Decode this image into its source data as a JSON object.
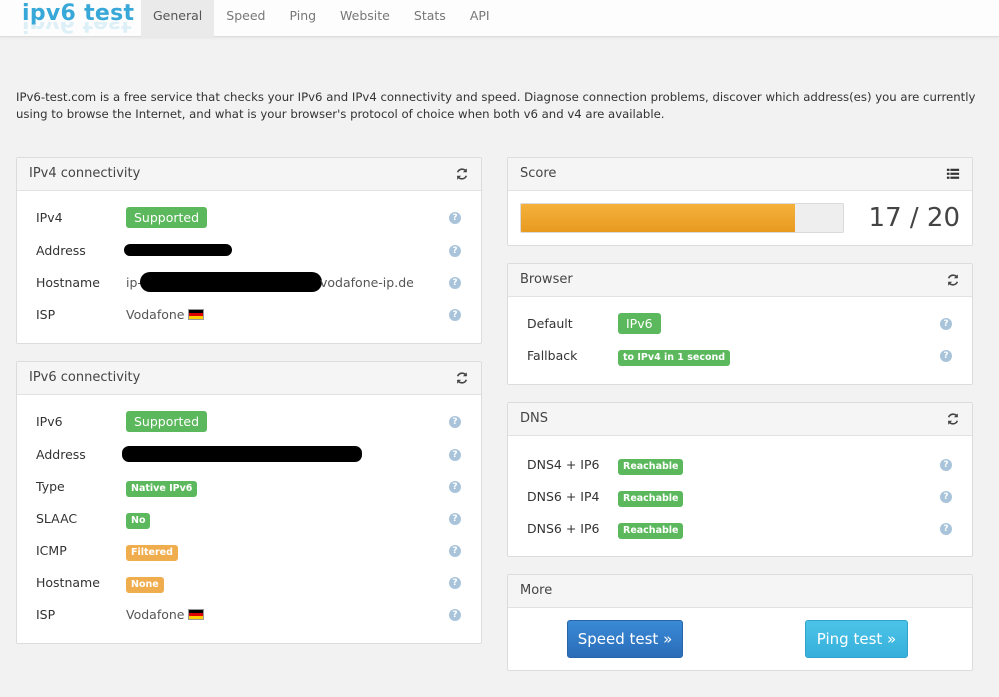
{
  "brand": {
    "name": "ipv6 test"
  },
  "nav": {
    "tabs": [
      {
        "label": "General"
      },
      {
        "label": "Speed"
      },
      {
        "label": "Ping"
      },
      {
        "label": "Website"
      },
      {
        "label": "Stats"
      },
      {
        "label": "API"
      }
    ],
    "active": "General"
  },
  "intro": "IPv6-test.com is a free service that checks your IPv6 and IPv4 connectivity and speed. Diagnose connection problems, discover which address(es) you are currently using to browse the Internet, and what is your browser's protocol of choice when both v6 and v4 are available.",
  "ipv4": {
    "title": "IPv4 connectivity",
    "rows": [
      {
        "label": "IPv4",
        "value": "Supported"
      },
      {
        "label": "Address",
        "value": ""
      },
      {
        "label": "Hostname",
        "value_prefix": "ip-",
        "value_suffix": "vodafone-ip.de"
      },
      {
        "label": "ISP",
        "value": "Vodafone"
      }
    ]
  },
  "ipv6": {
    "title": "IPv6 connectivity",
    "rows": [
      {
        "label": "IPv6",
        "value": "Supported"
      },
      {
        "label": "Address",
        "value": ""
      },
      {
        "label": "Type",
        "value": "Native IPv6"
      },
      {
        "label": "SLAAC",
        "value": "No"
      },
      {
        "label": "ICMP",
        "value": "Filtered"
      },
      {
        "label": "Hostname",
        "value": "None"
      },
      {
        "label": "ISP",
        "value": "Vodafone"
      }
    ]
  },
  "score": {
    "title": "Score",
    "text": "17 / 20",
    "fraction": 0.85
  },
  "browser": {
    "title": "Browser",
    "rows": [
      {
        "label": "Default",
        "value": "IPv6"
      },
      {
        "label": "Fallback",
        "value": "to IPv4 in 1 second"
      }
    ]
  },
  "dns": {
    "title": "DNS",
    "rows": [
      {
        "label": "DNS4 + IP6",
        "value": "Reachable"
      },
      {
        "label": "DNS6 + IP4",
        "value": "Reachable"
      },
      {
        "label": "DNS6 + IP6",
        "value": "Reachable"
      }
    ]
  },
  "more": {
    "title": "More",
    "speed_test": "Speed test »",
    "ping_test": "Ping test »"
  },
  "help_glyph": "?",
  "colors": {
    "success": "#5cb85c",
    "warning": "#f0ad4e",
    "primary": "#2a6cb8",
    "info": "#36b0db",
    "brand": "#38a8d8"
  }
}
